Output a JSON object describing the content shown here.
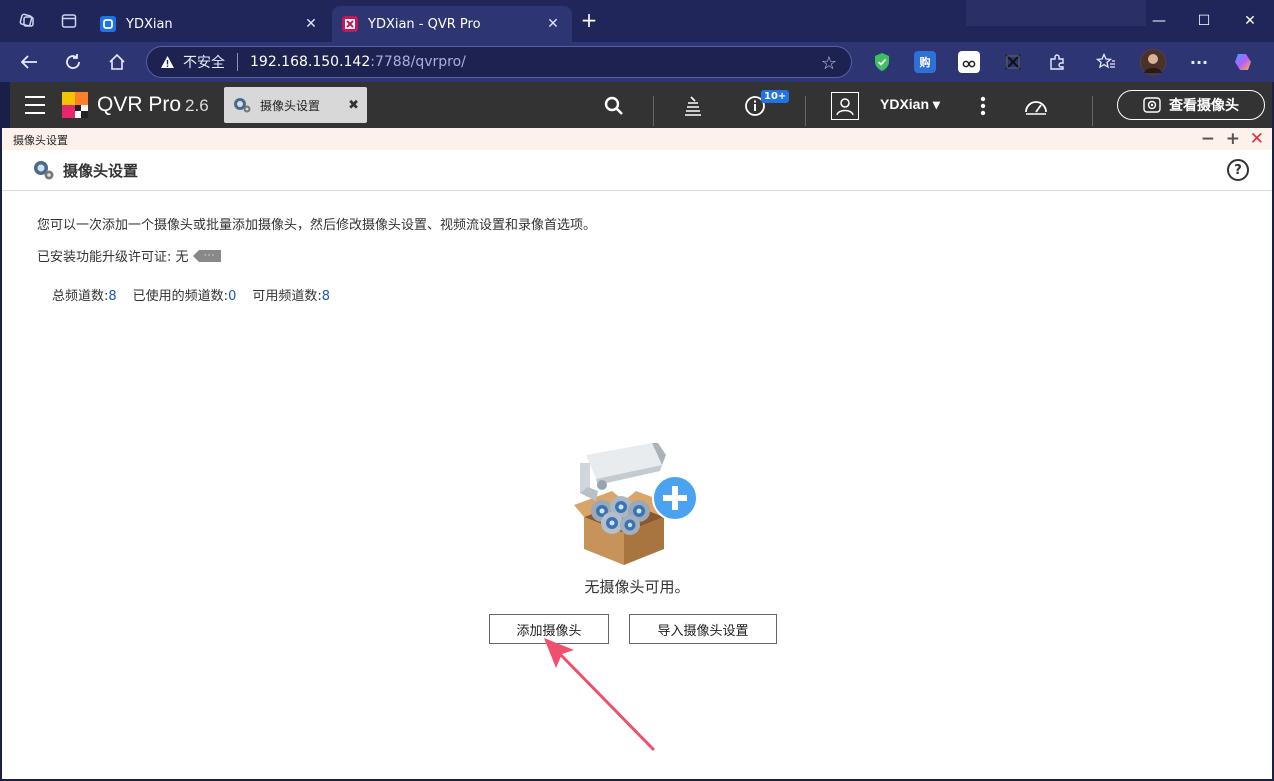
{
  "browser": {
    "tabs": [
      {
        "title": "YDXian",
        "active": false,
        "favicon_color": "#1e73e8"
      },
      {
        "title": "YDXian - QVR Pro",
        "active": true,
        "favicon_color": "#c2185b"
      }
    ],
    "address": {
      "security_label": "不安全",
      "host": "192.168.150.142",
      "path": ":7788/qvrpro/"
    }
  },
  "app": {
    "brand": "QVR Pro",
    "version": "2.6",
    "open_tab": "摄像头设置",
    "notification_badge": "10+",
    "user": "YDXian",
    "view_cameras_label": "查看摄像头"
  },
  "window": {
    "title": "摄像头设置",
    "page_title": "摄像头设置",
    "description": "您可以一次添加一个摄像头或批量添加摄像头，然后修改摄像头设置、视频流设置和录像首选项。",
    "license_label": "已安装功能升级许可证: 无",
    "channels": {
      "total_label": "总频道数:",
      "total_value": "8",
      "used_label": "已使用的频道数:",
      "used_value": "0",
      "available_label": "可用频道数:",
      "available_value": "8"
    },
    "empty_message": "无摄像头可用。",
    "add_camera_label": "添加摄像头",
    "import_settings_label": "导入摄像头设置"
  },
  "colors": {
    "browser_tabstrip": "#21265a",
    "browser_toolbar": "#2e3573",
    "app_header": "#333333",
    "accent_blue": "#1e73e8",
    "arrow_red": "#f0506e"
  }
}
